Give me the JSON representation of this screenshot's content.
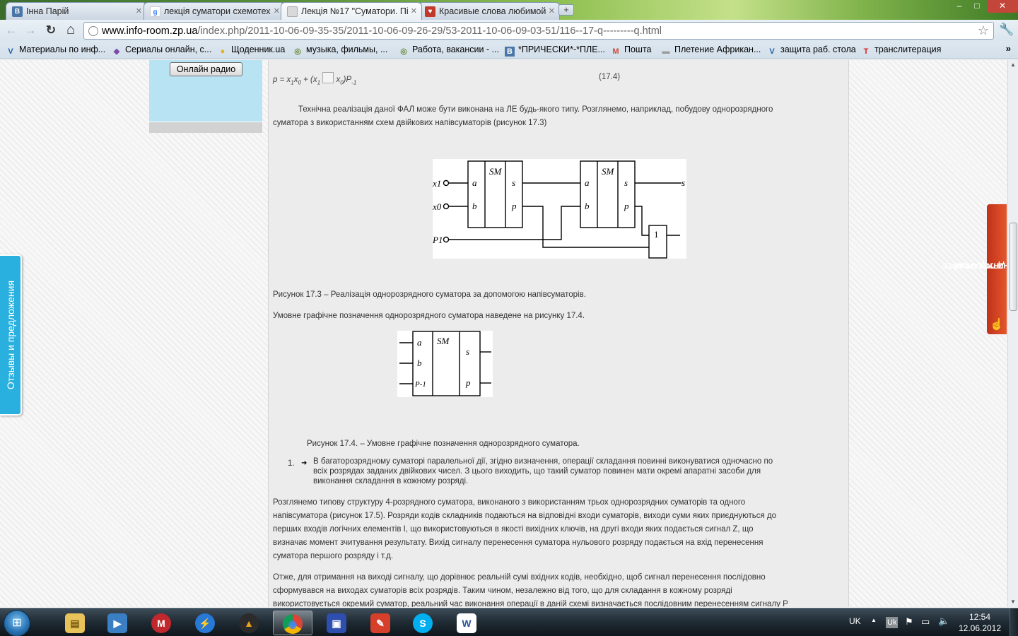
{
  "browser": {
    "tabs": [
      {
        "title": "Інна Парій",
        "favicon": "vk-icon",
        "favicon_color": "#4a76a8",
        "favicon_text": "B"
      },
      {
        "title": "лекція суматори схемотех",
        "favicon": "google-icon",
        "favicon_color": "#ffffff",
        "favicon_text": "g"
      },
      {
        "title": "Лекція №17 \"Суматори. Пі",
        "favicon": "page-icon",
        "favicon_color": "#d9d9d9",
        "favicon_text": ""
      },
      {
        "title": "Красивые слова любимой",
        "favicon": "site-icon",
        "favicon_color": "#c0392b",
        "favicon_text": "♥"
      }
    ],
    "active_tab_index": 2,
    "new_tab_label": "+",
    "window_controls": {
      "minimize": "–",
      "maximize": "□",
      "close": "✕"
    },
    "address": {
      "host": "www.info-room.zp.ua",
      "path": "/index.php/2011-10-06-09-35-35/2011-10-06-09-26-29/53-2011-10-06-09-03-51/116--17-q---------q.html"
    },
    "nav": {
      "back": "←",
      "forward": "→",
      "reload": "↻",
      "home": "⌂",
      "star": "☆",
      "wrench": "🔧"
    },
    "bookmarks": [
      {
        "label": "Материалы по инф...",
        "icon": "bookmark-flag-icon",
        "color": "#1d5fa7",
        "glyph": "V"
      },
      {
        "label": "Сериалы онлайн, с...",
        "icon": "film-icon",
        "color": "#7b4aa8",
        "glyph": "◆"
      },
      {
        "label": "Щоденник.ua",
        "icon": "bulb-icon",
        "color": "#e3b21a",
        "glyph": "●"
      },
      {
        "label": "музыка, фильмы, ...",
        "icon": "globe-icon",
        "color": "#6d8b3d",
        "glyph": "◎"
      },
      {
        "label": "Работа, вакансии - ...",
        "icon": "globe-icon",
        "color": "#6d8b3d",
        "glyph": "◎"
      },
      {
        "label": "*ПРИЧЕСКИ*-*ПЛЕ...",
        "icon": "vk-icon",
        "color": "#4a76a8",
        "glyph": "B"
      },
      {
        "label": "Пошта",
        "icon": "gmail-icon",
        "color": "#d14836",
        "glyph": "M"
      },
      {
        "label": "Плетение Африкан...",
        "icon": "page-icon",
        "color": "#999999",
        "glyph": "▬"
      },
      {
        "label": "защита раб. стола",
        "icon": "bookmark-flag-icon",
        "color": "#1d5fa7",
        "glyph": "V"
      },
      {
        "label": "транслитерация",
        "icon": "translit-icon",
        "color": "#e02020",
        "glyph": "T"
      }
    ],
    "bookmarks_more": "»"
  },
  "page": {
    "radio_button": "Онлайн радио",
    "formula": {
      "parts": [
        "p = x",
        "1",
        "x",
        "0",
        " + (x",
        "1",
        " ",
        "x",
        "0",
        ")P",
        "-1"
      ],
      "number": "(17.4)"
    },
    "para1_line1": "Технічна реалізація даної ФАЛ може бути виконана на ЛЕ будь-якого типу. Розглянемо, наприклад, побудову однорозрядного",
    "para1_line2": "суматора з використанням схем двійкових напівсуматорів (рисунок 17.3)",
    "fig1": {
      "block_label": "SM",
      "inputs": [
        "x1",
        "x0",
        "P1"
      ],
      "pins_in": [
        "a",
        "b"
      ],
      "pins_out": [
        "s",
        "p"
      ],
      "output": "s",
      "or_gate": "1"
    },
    "fig1_caption": "Рисунок 17.3 – Реалізація однорозрядного суматора за допомогою напівсуматорів.",
    "para2": "Умовне графічне позначення однорозрядного суматора наведене на рисунку 17.4.",
    "fig2": {
      "block_label": "SM",
      "pins_in": [
        "a",
        "b",
        "P-1"
      ],
      "pins_out": [
        "s",
        "p"
      ]
    },
    "fig2_caption": "Рисунок 17.4. – Умовне графічне позначення однорозрядного суматора.",
    "list_number": "1.",
    "list_line1": "В багаторозрядному суматорі паралельної дії, згідно визначення, операції складання повинні виконуватися одночасно по",
    "list_line2": "всіх розрядах заданих двійкових чисел. З цього виходить, що такий суматор повинен мати окремі апаратні засоби для",
    "list_line3": "виконання складання в кожному розряді.",
    "para3_line1": "Розглянемо типову структуру 4-розрядного суматора, виконаного з використанням трьох однорозрядних суматорів та одного",
    "para3_line2": "напівсуматора (рисунок 17.5). Розряди кодів складників подаються на відповідні входи суматорів, виходи суми яких приєднуються до",
    "para3_line3": "перших входів логічних елементів І, що використовуються в якості вихідних ключів, на другі входи яких подається сигнал Z, що",
    "para3_line4": "визначає момент зчитування результату. Вихід сигналу перенесення суматора нульового розряду подається на вхід перенесення",
    "para3_line5": "суматора першого розряду і т.д.",
    "para4_line1": "Отже, для отримання на виході сигналу, що дорівнює реальній сумі вхідних кодів, необхідно, щоб сигнал перенесення послідовно",
    "para4_line2": "сформувався на виходах суматорів всіх розрядів. Таким чином, незалежно від того, що для складання в кожному розряді",
    "para4_line3": "використовується окремий суматор, реальний час виконання операції в даній схемі визначається послідовним перенесенням сигналу P",
    "feedback_tab": "Отзывы и предложения",
    "gift_tab_line1": "РАССКАЖИ ДРУГУ О САЙТЕ",
    "gift_tab_line2": "И ПОЛУЧИ ПОДАРОК!"
  },
  "scrollbar": {
    "up": "▲",
    "down": "▼"
  },
  "taskbar": {
    "start": "⊞",
    "apps": [
      {
        "name": "explorer",
        "icon": "folder-icon",
        "color": "#e8c35a",
        "glyph": "▤"
      },
      {
        "name": "media",
        "icon": "media-player-icon",
        "color": "#3a7fc4",
        "glyph": "▶"
      },
      {
        "name": "maxthon",
        "icon": "browser-m-icon",
        "color": "#c0282d",
        "glyph": "M"
      },
      {
        "name": "flash-downloader",
        "icon": "lightning-icon",
        "color": "#2878d6",
        "glyph": "⚡"
      },
      {
        "name": "aimp",
        "icon": "triangle-icon",
        "color": "#e7a21e",
        "glyph": "▲"
      },
      {
        "name": "chrome",
        "icon": "chrome-icon",
        "color": "#3a9b4d",
        "glyph": "◉"
      },
      {
        "name": "disk",
        "icon": "floppy-icon",
        "color": "#2e4fb0",
        "glyph": "▣"
      },
      {
        "name": "paint",
        "icon": "paint-icon",
        "color": "#d6402b",
        "glyph": "✎"
      },
      {
        "name": "skype",
        "icon": "skype-icon",
        "color": "#00aff0",
        "glyph": "S"
      },
      {
        "name": "word",
        "icon": "word-icon",
        "color": "#2a5699",
        "glyph": "W"
      }
    ],
    "active_app_index": 5,
    "tray": {
      "lang": "UK",
      "lang_badge": "Uk",
      "arrow": "▲",
      "flag": "⚑",
      "network": "▭",
      "volume": "🔈"
    },
    "time": "12:54",
    "date": "12.06.2012"
  }
}
